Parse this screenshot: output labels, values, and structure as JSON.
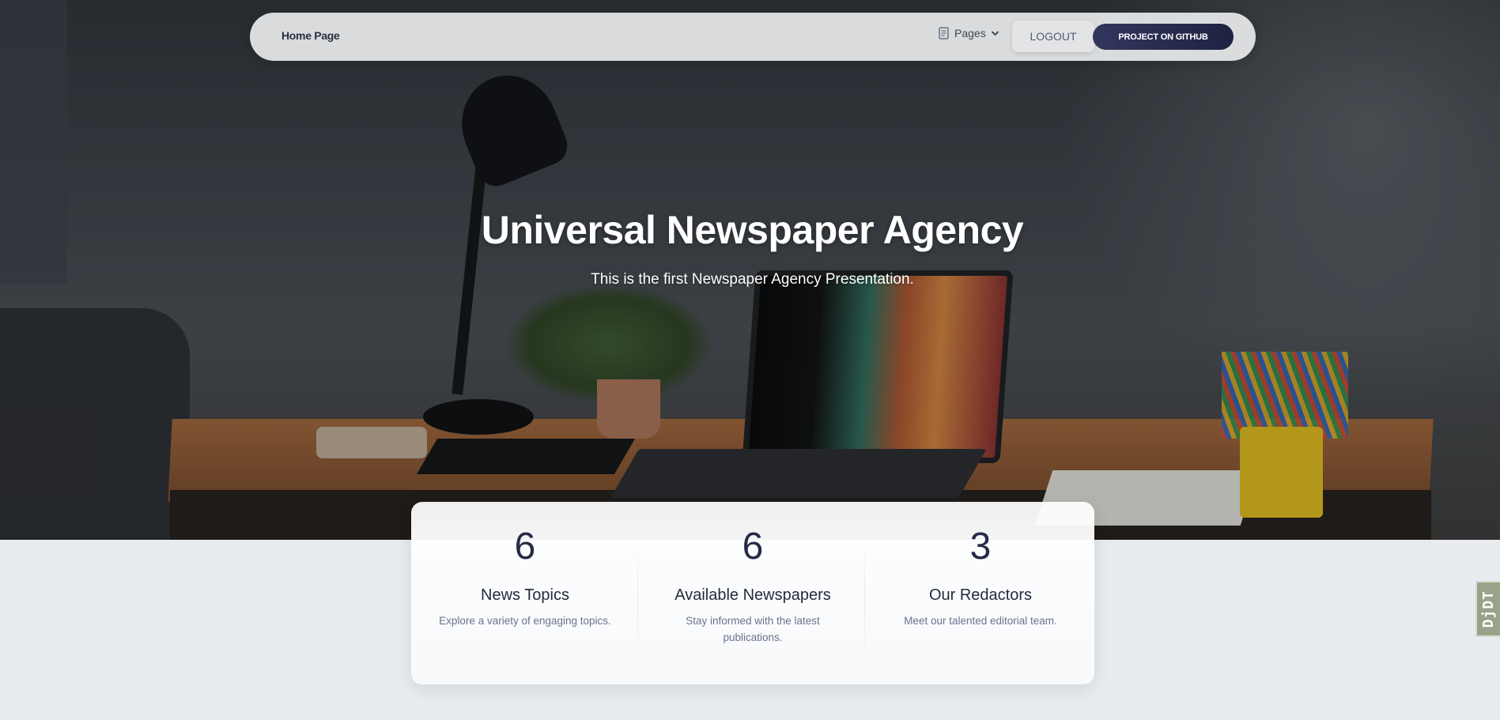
{
  "nav": {
    "home_label": "Home Page",
    "pages_label": "Pages",
    "pages_icon": "document-icon",
    "chevron_icon": "chevron-down-icon",
    "logout_label": "LOGOUT",
    "github_label": "PROJECT ON GITHUB"
  },
  "hero": {
    "title": "Universal Newspaper Agency",
    "subtitle": "This is the first Newspaper Agency Presentation."
  },
  "stats": [
    {
      "value": "6",
      "label": "News Topics",
      "description": "Explore a variety of engaging topics."
    },
    {
      "value": "6",
      "label": "Available Newspapers",
      "description": "Stay informed with the latest publications."
    },
    {
      "value": "3",
      "label": "Our Redactors",
      "description": "Meet our talented editorial team."
    }
  ],
  "side_badge": {
    "text": "DjDT"
  },
  "colors": {
    "accent": "#262b47",
    "github_button": "#1e2341",
    "page_background": "#e9ecef"
  }
}
